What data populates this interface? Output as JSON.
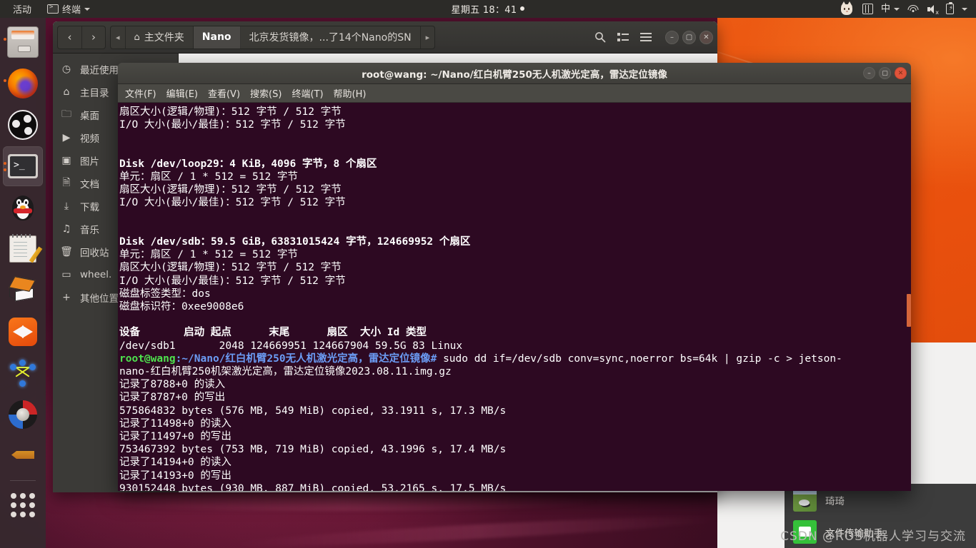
{
  "topbar": {
    "activities": "活动",
    "app_icon": "terminal-icon",
    "app_name": "终端",
    "clock": "星期五 18：41",
    "indicators": [
      {
        "name": "cat-tray-icon",
        "label": ""
      },
      {
        "name": "keyboard-layout-icon",
        "label": ""
      },
      {
        "name": "input-method-indicator",
        "label": "中"
      },
      {
        "name": "wifi-icon",
        "label": ""
      },
      {
        "name": "volume-muted-icon",
        "label": ""
      },
      {
        "name": "battery-icon",
        "label": ""
      }
    ]
  },
  "dock": {
    "items": [
      {
        "name": "files",
        "icon": "files-icon",
        "running": true,
        "active": false
      },
      {
        "name": "firefox",
        "icon": "firefox-icon",
        "running": true,
        "active": false
      },
      {
        "name": "obs-studio",
        "icon": "obs-icon",
        "running": false,
        "active": false
      },
      {
        "name": "terminal",
        "icon": "terminal-icon",
        "running": true,
        "active": true
      },
      {
        "name": "qq",
        "icon": "qq-penguin-icon",
        "running": false,
        "active": false
      },
      {
        "name": "text-editor",
        "icon": "notes-icon",
        "running": false,
        "active": false
      },
      {
        "name": "software-center",
        "icon": "box-icon",
        "running": false,
        "active": false
      },
      {
        "name": "media-player",
        "icon": "media-icon",
        "running": false,
        "active": false
      },
      {
        "name": "ros-rqt-graph",
        "icon": "graph-icon",
        "running": false,
        "active": false
      },
      {
        "name": "gazebo",
        "icon": "wheel-icon",
        "running": false,
        "active": false
      },
      {
        "name": "arrow-app",
        "icon": "arrow-icon",
        "running": false,
        "active": false
      },
      {
        "name": "show-applications",
        "icon": "app-grid-icon",
        "running": false,
        "active": false
      }
    ]
  },
  "file_manager": {
    "nav": {
      "back": "‹",
      "forward": "›",
      "prev_crumb": "◂",
      "next_crumb": "▸"
    },
    "breadcrumbs": [
      {
        "label": "主文件夹",
        "icon": "home-icon",
        "active": false
      },
      {
        "label": "Nano",
        "icon": "",
        "active": true
      },
      {
        "label": "北京发货镜像，...了14个Nano的SN",
        "icon": "",
        "active": false
      }
    ],
    "toolbar": {
      "search": "search-icon",
      "view_list": "list-view-icon",
      "menu": "hamburger-menu-icon",
      "minimize": "–",
      "maximize": "▢",
      "close": "✕"
    },
    "sidebar": [
      {
        "label": "最近使用",
        "icon": "clock-icon"
      },
      {
        "label": "主目录",
        "icon": "home-icon"
      },
      {
        "label": "桌面",
        "icon": "folder-icon"
      },
      {
        "label": "视频",
        "icon": "video-icon"
      },
      {
        "label": "图片",
        "icon": "photo-icon"
      },
      {
        "label": "文档",
        "icon": "document-icon"
      },
      {
        "label": "下载",
        "icon": "download-icon"
      },
      {
        "label": "音乐",
        "icon": "music-icon"
      },
      {
        "label": "回收站",
        "icon": "trash-icon"
      },
      {
        "label": "wheel.",
        "icon": "drive-icon"
      },
      {
        "label": "其他位置",
        "icon": "plus-icon"
      }
    ]
  },
  "terminal": {
    "title": "root@wang: ~/Nano/红白机臂250无人机激光定高，雷达定位镜像",
    "window_buttons": {
      "minimize": "–",
      "maximize": "▢",
      "close": "✕"
    },
    "menu": [
      "文件(F)",
      "编辑(E)",
      "查看(V)",
      "搜索(S)",
      "终端(T)",
      "帮助(H)"
    ],
    "lines": [
      {
        "text": "扇区大小(逻辑/物理)：512 字节 / 512 字节",
        "bold": false
      },
      {
        "text": "I/O 大小(最小/最佳)：512 字节 / 512 字节",
        "bold": false
      },
      {
        "text": "",
        "bold": false
      },
      {
        "text": "",
        "bold": false
      },
      {
        "text": "Disk /dev/loop29：4 KiB，4096 字节，8 个扇区",
        "bold": true
      },
      {
        "text": "单元：扇区 / 1 * 512 = 512 字节",
        "bold": false
      },
      {
        "text": "扇区大小(逻辑/物理)：512 字节 / 512 字节",
        "bold": false
      },
      {
        "text": "I/O 大小(最小/最佳)：512 字节 / 512 字节",
        "bold": false
      },
      {
        "text": "",
        "bold": false
      },
      {
        "text": "",
        "bold": false
      },
      {
        "text": "Disk /dev/sdb：59.5 GiB，63831015424 字节，124669952 个扇区",
        "bold": true
      },
      {
        "text": "单元：扇区 / 1 * 512 = 512 字节",
        "bold": false
      },
      {
        "text": "扇区大小(逻辑/物理)：512 字节 / 512 字节",
        "bold": false
      },
      {
        "text": "I/O 大小(最小/最佳)：512 字节 / 512 字节",
        "bold": false
      },
      {
        "text": "磁盘标签类型：dos",
        "bold": false
      },
      {
        "text": "磁盘标识符：0xee9008e6",
        "bold": false
      },
      {
        "text": "",
        "bold": false
      },
      {
        "text": "设备       启动 起点      末尾      扇区  大小 Id 类型",
        "bold": true
      },
      {
        "text": "/dev/sdb1       2048 124669951 124667904 59.5G 83 Linux",
        "bold": false
      }
    ],
    "prompt": {
      "user": "root@wang",
      "path": ":~/Nano/红白机臂250无人机激光定高，雷达定位镜像# ",
      "command": "sudo dd if=/dev/sdb conv=sync,noerror bs=64k | gzip -c > jetson-"
    },
    "output": [
      "nano-红白机臂250机架激光定高，雷达定位镜像2023.08.11.img.gz",
      "记录了8788+0 的读入",
      "记录了8787+0 的写出",
      "575864832 bytes (576 MB, 549 MiB) copied, 33.1911 s, 17.3 MB/s",
      "记录了11498+0 的读入",
      "记录了11497+0 的写出",
      "753467392 bytes (753 MB, 719 MiB) copied, 43.1996 s, 17.4 MB/s",
      "记录了14194+0 的读入",
      "记录了14193+0 的写出",
      "930152448 bytes (930 MB, 887 MiB) copied, 53.2165 s, 17.5 MB/s"
    ]
  },
  "qq_panel": {
    "contacts": [
      {
        "name": "琦琦",
        "avatar": "photo-avatar"
      },
      {
        "name": "文件传输助手",
        "avatar": "file-transfer-avatar"
      }
    ]
  },
  "watermark": "CSDN @ROS机器人学习与交流"
}
